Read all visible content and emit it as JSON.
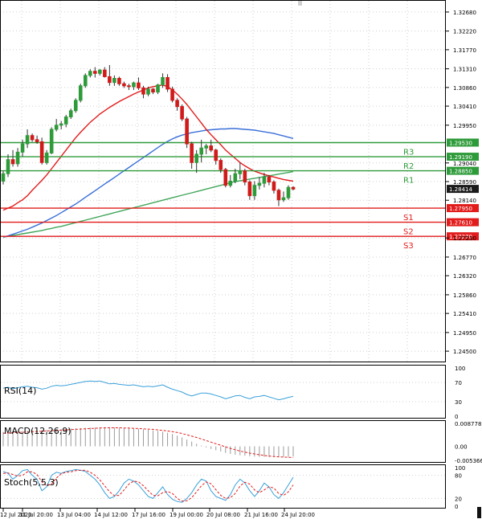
{
  "colors": {
    "bull": "#2e9b3a",
    "bear": "#d11a1a",
    "ma_fast": "#e21b1b",
    "ma_mid": "#3a6fd8",
    "ma_slow": "#41a65a",
    "resistance": "#2e9b3a",
    "support": "#e21b1b",
    "current": "#1a1a1a",
    "grid": "#cfcfcf",
    "rsi": "#3aa0d8",
    "macd_signal": "#e21b1b",
    "stoch_k": "#3aa0d8",
    "stoch_d": "#e21b1b"
  },
  "chart_data": [
    {
      "type": "candlestick",
      "title": "",
      "ylim": [
        1.2425,
        1.3295
      ],
      "price_ticks": [
        "1.32680",
        "1.32220",
        "1.31770",
        "1.31310",
        "1.30860",
        "1.30410",
        "1.29950",
        "1.29040",
        "1.28590",
        "1.28140",
        "1.27230",
        "1.26770",
        "1.26320",
        "1.25860",
        "1.25410",
        "1.24950",
        "1.24500"
      ],
      "x_labels": [
        "12 Jul 2020",
        "11 Jul 20:00",
        "13 Jul 04:00",
        "14 Jul 12:00",
        "17 Jul 16:00",
        "19 Jul 00:00",
        "20 Jul 08:00",
        "21 Jul 16:00",
        "24 Jul 20:00"
      ],
      "current_price": "1.28414",
      "levels": [
        {
          "name": "R3",
          "value": 1.2953,
          "label": "1.29530",
          "kind": "resistance"
        },
        {
          "name": "R2",
          "value": 1.2919,
          "label": "1.29190",
          "kind": "resistance"
        },
        {
          "name": "R1",
          "value": 1.2885,
          "label": "1.28850",
          "kind": "resistance"
        },
        {
          "name": "S1",
          "value": 1.2795,
          "label": "1.27950",
          "kind": "support"
        },
        {
          "name": "S2",
          "value": 1.2761,
          "label": "1.27610",
          "kind": "support"
        },
        {
          "name": "S3",
          "value": 1.2727,
          "label": "1.27270",
          "kind": "support"
        }
      ],
      "candles": [
        {
          "o": 1.286,
          "h": 1.2885,
          "l": 1.2852,
          "c": 1.2878
        },
        {
          "o": 1.2878,
          "h": 1.2925,
          "l": 1.287,
          "c": 1.2912
        },
        {
          "o": 1.2912,
          "h": 1.2935,
          "l": 1.2895,
          "c": 1.2902
        },
        {
          "o": 1.2902,
          "h": 1.294,
          "l": 1.2895,
          "c": 1.293
        },
        {
          "o": 1.293,
          "h": 1.296,
          "l": 1.292,
          "c": 1.295
        },
        {
          "o": 1.295,
          "h": 1.2985,
          "l": 1.294,
          "c": 1.297
        },
        {
          "o": 1.297,
          "h": 1.2975,
          "l": 1.2955,
          "c": 1.296
        },
        {
          "o": 1.296,
          "h": 1.297,
          "l": 1.295,
          "c": 1.2955
        },
        {
          "o": 1.2955,
          "h": 1.2965,
          "l": 1.29,
          "c": 1.2905
        },
        {
          "o": 1.2905,
          "h": 1.2935,
          "l": 1.29,
          "c": 1.2928
        },
        {
          "o": 1.2928,
          "h": 1.299,
          "l": 1.2925,
          "c": 1.2985
        },
        {
          "o": 1.2985,
          "h": 1.301,
          "l": 1.298,
          "c": 1.2995
        },
        {
          "o": 1.2995,
          "h": 1.3005,
          "l": 1.2985,
          "c": 1.2998
        },
        {
          "o": 1.2998,
          "h": 1.302,
          "l": 1.299,
          "c": 1.3015
        },
        {
          "o": 1.3015,
          "h": 1.3035,
          "l": 1.301,
          "c": 1.303
        },
        {
          "o": 1.303,
          "h": 1.306,
          "l": 1.3025,
          "c": 1.3055
        },
        {
          "o": 1.3055,
          "h": 1.3095,
          "l": 1.305,
          "c": 1.309
        },
        {
          "o": 1.309,
          "h": 1.312,
          "l": 1.3085,
          "c": 1.3115
        },
        {
          "o": 1.3115,
          "h": 1.313,
          "l": 1.311,
          "c": 1.3125
        },
        {
          "o": 1.3125,
          "h": 1.3135,
          "l": 1.311,
          "c": 1.312
        },
        {
          "o": 1.312,
          "h": 1.313,
          "l": 1.3115,
          "c": 1.3128
        },
        {
          "o": 1.3128,
          "h": 1.3135,
          "l": 1.311,
          "c": 1.3112
        },
        {
          "o": 1.3112,
          "h": 1.314,
          "l": 1.309,
          "c": 1.3098
        },
        {
          "o": 1.3098,
          "h": 1.3115,
          "l": 1.309,
          "c": 1.3108
        },
        {
          "o": 1.3108,
          "h": 1.3112,
          "l": 1.309,
          "c": 1.3095
        },
        {
          "o": 1.3095,
          "h": 1.31,
          "l": 1.3085,
          "c": 1.309
        },
        {
          "o": 1.309,
          "h": 1.3095,
          "l": 1.308,
          "c": 1.3088
        },
        {
          "o": 1.3088,
          "h": 1.31,
          "l": 1.308,
          "c": 1.3097
        },
        {
          "o": 1.3097,
          "h": 1.311,
          "l": 1.308,
          "c": 1.3085
        },
        {
          "o": 1.3085,
          "h": 1.309,
          "l": 1.306,
          "c": 1.307
        },
        {
          "o": 1.307,
          "h": 1.3088,
          "l": 1.3065,
          "c": 1.3082
        },
        {
          "o": 1.3082,
          "h": 1.3085,
          "l": 1.307,
          "c": 1.3075
        },
        {
          "o": 1.3075,
          "h": 1.3095,
          "l": 1.307,
          "c": 1.3092
        },
        {
          "o": 1.3092,
          "h": 1.312,
          "l": 1.3085,
          "c": 1.311
        },
        {
          "o": 1.311,
          "h": 1.3118,
          "l": 1.3075,
          "c": 1.3082
        },
        {
          "o": 1.3082,
          "h": 1.3088,
          "l": 1.305,
          "c": 1.3055
        },
        {
          "o": 1.3055,
          "h": 1.306,
          "l": 1.303,
          "c": 1.304
        },
        {
          "o": 1.304,
          "h": 1.3045,
          "l": 1.3005,
          "c": 1.301
        },
        {
          "o": 1.301,
          "h": 1.3015,
          "l": 1.294,
          "c": 1.295
        },
        {
          "o": 1.295,
          "h": 1.2955,
          "l": 1.289,
          "c": 1.2905
        },
        {
          "o": 1.2905,
          "h": 1.2935,
          "l": 1.288,
          "c": 1.2925
        },
        {
          "o": 1.2925,
          "h": 1.296,
          "l": 1.2905,
          "c": 1.294
        },
        {
          "o": 1.294,
          "h": 1.295,
          "l": 1.2925,
          "c": 1.2945
        },
        {
          "o": 1.2945,
          "h": 1.296,
          "l": 1.293,
          "c": 1.2935
        },
        {
          "o": 1.2935,
          "h": 1.2938,
          "l": 1.29,
          "c": 1.291
        },
        {
          "o": 1.291,
          "h": 1.2915,
          "l": 1.288,
          "c": 1.2888
        },
        {
          "o": 1.2888,
          "h": 1.2892,
          "l": 1.2845,
          "c": 1.285
        },
        {
          "o": 1.285,
          "h": 1.2875,
          "l": 1.2845,
          "c": 1.286
        },
        {
          "o": 1.286,
          "h": 1.289,
          "l": 1.2855,
          "c": 1.2878
        },
        {
          "o": 1.2878,
          "h": 1.2905,
          "l": 1.2865,
          "c": 1.2885
        },
        {
          "o": 1.2885,
          "h": 1.289,
          "l": 1.285,
          "c": 1.2858
        },
        {
          "o": 1.2858,
          "h": 1.2862,
          "l": 1.2815,
          "c": 1.2825
        },
        {
          "o": 1.2825,
          "h": 1.286,
          "l": 1.2815,
          "c": 1.285
        },
        {
          "o": 1.285,
          "h": 1.287,
          "l": 1.284,
          "c": 1.2855
        },
        {
          "o": 1.2855,
          "h": 1.288,
          "l": 1.2845,
          "c": 1.287
        },
        {
          "o": 1.287,
          "h": 1.2875,
          "l": 1.285,
          "c": 1.2858
        },
        {
          "o": 1.2858,
          "h": 1.2862,
          "l": 1.283,
          "c": 1.2838
        },
        {
          "o": 1.2838,
          "h": 1.2842,
          "l": 1.28,
          "c": 1.2815
        },
        {
          "o": 1.2815,
          "h": 1.2835,
          "l": 1.281,
          "c": 1.282
        },
        {
          "o": 1.282,
          "h": 1.285,
          "l": 1.2815,
          "c": 1.2845
        },
        {
          "o": 1.2845,
          "h": 1.2848,
          "l": 1.2838,
          "c": 1.2841
        }
      ],
      "ma_fast": [
        1.279,
        1.2795,
        1.28,
        1.2808,
        1.2815,
        1.2825,
        1.2838,
        1.285,
        1.2862,
        1.2875,
        1.289,
        1.2905,
        1.292,
        1.2935,
        1.295,
        1.2965,
        1.2978,
        1.299,
        1.3002,
        1.3012,
        1.3022,
        1.303,
        1.3038,
        1.3045,
        1.3052,
        1.3058,
        1.3064,
        1.307,
        1.3075,
        1.308,
        1.3085,
        1.3088,
        1.309,
        1.3092,
        1.3088,
        1.308,
        1.307,
        1.3058,
        1.3045,
        1.303,
        1.3015,
        1.3,
        1.2985,
        1.2972,
        1.296,
        1.2948,
        1.2935,
        1.2925,
        1.2915,
        1.2905,
        1.2897,
        1.289,
        1.2884,
        1.288,
        1.2876,
        1.2873,
        1.287,
        1.2867,
        1.2864,
        1.2862,
        1.286
      ],
      "ma_mid": [
        1.2725,
        1.2728,
        1.2732,
        1.2736,
        1.274,
        1.2744,
        1.2749,
        1.2754,
        1.2759,
        1.2765,
        1.2771,
        1.2777,
        1.2784,
        1.2791,
        1.2798,
        1.2805,
        1.2813,
        1.2821,
        1.2829,
        1.2837,
        1.2845,
        1.2853,
        1.2861,
        1.2869,
        1.2877,
        1.2885,
        1.2893,
        1.2901,
        1.2909,
        1.2917,
        1.2925,
        1.2933,
        1.2941,
        1.2949,
        1.2956,
        1.2962,
        1.2967,
        1.2971,
        1.2974,
        1.2977,
        1.2979,
        1.2981,
        1.2983,
        1.2984,
        1.2985,
        1.2986,
        1.2986,
        1.2987,
        1.2987,
        1.2986,
        1.2985,
        1.2984,
        1.2983,
        1.2981,
        1.2979,
        1.2977,
        1.2975,
        1.2972,
        1.2969,
        1.2966,
        1.2963
      ],
      "ma_slow": [
        1.2725,
        1.2727,
        1.2729,
        1.2731,
        1.2733,
        1.2735,
        1.2737,
        1.2739,
        1.2741,
        1.2744,
        1.2746,
        1.2749,
        1.2751,
        1.2754,
        1.2757,
        1.276,
        1.2763,
        1.2766,
        1.2769,
        1.2772,
        1.2775,
        1.2778,
        1.2781,
        1.2784,
        1.2787,
        1.279,
        1.2793,
        1.2796,
        1.2799,
        1.2802,
        1.2805,
        1.2808,
        1.2811,
        1.2814,
        1.2817,
        1.282,
        1.2823,
        1.2826,
        1.2829,
        1.2832,
        1.2835,
        1.2838,
        1.2841,
        1.2844,
        1.2847,
        1.285,
        1.2853,
        1.2856,
        1.2859,
        1.2861,
        1.2863,
        1.2865,
        1.2867,
        1.2869,
        1.2871,
        1.2873,
        1.2875,
        1.2877,
        1.2879,
        1.2881,
        1.2883
      ]
    },
    {
      "type": "line",
      "title": "RSI(14)",
      "ylim": [
        0,
        100
      ],
      "ticks": [
        "100",
        "70",
        "30",
        "0"
      ],
      "values": [
        58,
        60,
        57,
        59,
        61,
        62,
        60,
        59,
        56,
        58,
        62,
        64,
        63,
        64,
        66,
        68,
        70,
        72,
        73,
        72,
        73,
        70,
        67,
        68,
        66,
        65,
        64,
        65,
        63,
        61,
        62,
        61,
        63,
        65,
        60,
        56,
        53,
        50,
        45,
        42,
        45,
        48,
        48,
        46,
        43,
        40,
        36,
        39,
        42,
        43,
        39,
        36,
        40,
        41,
        43,
        40,
        37,
        34,
        36,
        39,
        41
      ]
    },
    {
      "type": "bar",
      "title": "MACD(12,26,9)",
      "ylim": [
        -0.005366,
        0.008778
      ],
      "ticks": [
        "0.008778",
        "0.00",
        "-0.005366"
      ],
      "values": [
        0.0055,
        0.0056,
        0.0057,
        0.0058,
        0.0059,
        0.006,
        0.0061,
        0.0062,
        0.0062,
        0.0063,
        0.0064,
        0.0065,
        0.0066,
        0.0067,
        0.0068,
        0.0069,
        0.007,
        0.0071,
        0.0072,
        0.0072,
        0.0073,
        0.0073,
        0.0073,
        0.0072,
        0.0071,
        0.007,
        0.0069,
        0.0068,
        0.0067,
        0.0065,
        0.0063,
        0.0061,
        0.0059,
        0.0056,
        0.0052,
        0.0047,
        0.0041,
        0.0034,
        0.0026,
        0.0018,
        0.001,
        0.0003,
        -0.0004,
        -0.001,
        -0.0015,
        -0.002,
        -0.0025,
        -0.0029,
        -0.0032,
        -0.0034,
        -0.0036,
        -0.0038,
        -0.0039,
        -0.004,
        -0.004,
        -0.0041,
        -0.0041,
        -0.0041,
        -0.004,
        -0.004,
        -0.0039
      ],
      "signal": [
        0.005,
        0.0051,
        0.0052,
        0.0053,
        0.0054,
        0.0055,
        0.0056,
        0.0057,
        0.0058,
        0.0059,
        0.006,
        0.0061,
        0.0062,
        0.0063,
        0.0064,
        0.0065,
        0.0066,
        0.0067,
        0.0068,
        0.0069,
        0.007,
        0.0071,
        0.0071,
        0.0071,
        0.0071,
        0.007,
        0.007,
        0.0069,
        0.0068,
        0.0067,
        0.0066,
        0.0065,
        0.0063,
        0.0061,
        0.0059,
        0.0056,
        0.0053,
        0.0049,
        0.0044,
        0.0039,
        0.0034,
        0.0028,
        0.0022,
        0.0016,
        0.001,
        0.0004,
        -0.0002,
        -0.0008,
        -0.0013,
        -0.0018,
        -0.0022,
        -0.0026,
        -0.0029,
        -0.0032,
        -0.0035,
        -0.0037,
        -0.0039,
        -0.004,
        -0.0041,
        -0.0042,
        -0.0043
      ]
    },
    {
      "type": "line",
      "title": "Stoch(5,5,3)",
      "ylim": [
        0,
        100
      ],
      "ticks": [
        "100",
        "80",
        "20",
        "0"
      ],
      "k": [
        90,
        85,
        70,
        80,
        92,
        95,
        80,
        70,
        40,
        50,
        80,
        88,
        85,
        90,
        92,
        95,
        93,
        90,
        80,
        70,
        55,
        35,
        20,
        25,
        40,
        60,
        70,
        65,
        55,
        40,
        25,
        20,
        35,
        50,
        30,
        18,
        12,
        10,
        20,
        35,
        55,
        70,
        65,
        40,
        25,
        20,
        15,
        30,
        55,
        70,
        60,
        40,
        25,
        40,
        60,
        50,
        30,
        20,
        35,
        55,
        75
      ],
      "d": [
        85,
        86,
        82,
        78,
        80,
        89,
        89,
        82,
        63,
        53,
        57,
        73,
        84,
        88,
        89,
        92,
        93,
        93,
        88,
        80,
        68,
        53,
        37,
        27,
        28,
        42,
        57,
        65,
        63,
        53,
        40,
        28,
        27,
        35,
        38,
        33,
        20,
        13,
        14,
        22,
        37,
        53,
        63,
        58,
        43,
        28,
        20,
        22,
        33,
        52,
        62,
        57,
        42,
        35,
        42,
        50,
        47,
        33,
        28,
        37,
        55
      ]
    }
  ]
}
